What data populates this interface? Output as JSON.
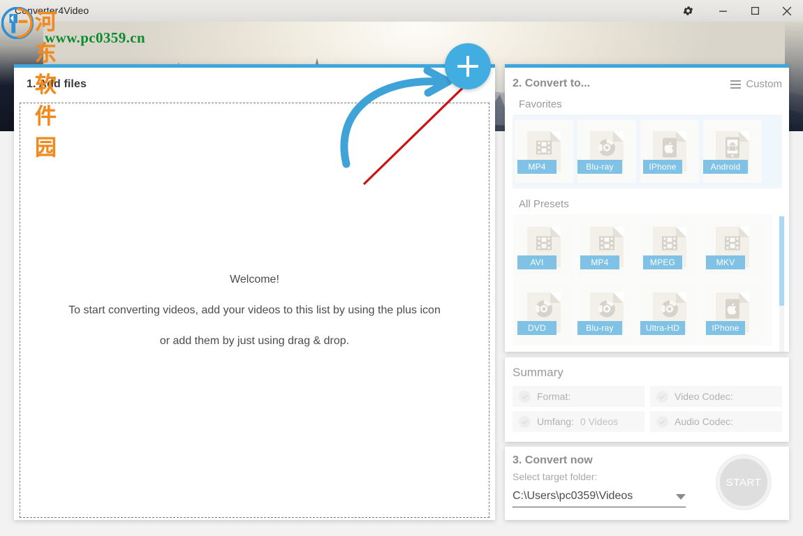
{
  "window": {
    "title": "Converter4Video",
    "controls": [
      {
        "name": "settings-button",
        "icon": "gear-icon"
      },
      {
        "name": "minimize-button",
        "icon": "minimize-icon"
      },
      {
        "name": "maximize-button",
        "icon": "maximize-icon"
      },
      {
        "name": "close-button",
        "icon": "close-icon"
      }
    ]
  },
  "watermark": {
    "chinese": "河东软件园",
    "url": "www.pc0359.cn"
  },
  "add_files": {
    "title": "1. Add files",
    "welcome_line1": "Welcome!",
    "welcome_line2": "To start converting videos, add your videos to this list by using the plus icon",
    "welcome_line3": "or add them by just using drag & drop.",
    "add_button_icon": "plus-icon"
  },
  "convert_to": {
    "title": "2. Convert to...",
    "custom_label": "Custom",
    "custom_icon": "hamburger-icon",
    "favorites_label": "Favorites",
    "favorites": [
      {
        "label": "MP4",
        "icon": "film-file-icon"
      },
      {
        "label": "Blu-ray",
        "icon": "disc-file-icon"
      },
      {
        "label": "IPhone",
        "icon": "apple-file-icon"
      },
      {
        "label": "Android",
        "icon": "android-file-icon"
      }
    ],
    "all_presets_label": "All Presets",
    "all_presets": [
      {
        "label": "AVI",
        "icon": "film-file-icon"
      },
      {
        "label": "MP4",
        "icon": "film-file-icon"
      },
      {
        "label": "MPEG",
        "icon": "film-file-icon"
      },
      {
        "label": "MKV",
        "icon": "film-file-icon"
      },
      {
        "label": "DVD",
        "icon": "disc-file-icon"
      },
      {
        "label": "Blu-ray",
        "icon": "disc-file-icon"
      },
      {
        "label": "Ultra-HD",
        "icon": "disc-file-icon"
      },
      {
        "label": "IPhone",
        "icon": "apple-file-icon"
      }
    ]
  },
  "summary": {
    "title": "Summary",
    "items": [
      {
        "label": "Format:",
        "value": ""
      },
      {
        "label": "Video Codec:",
        "value": ""
      },
      {
        "label": "Umfang:",
        "value": "0 Videos"
      },
      {
        "label": "Audio Codec:",
        "value": ""
      }
    ]
  },
  "convert_now": {
    "title": "3. Convert now",
    "folder_label": "Select target folder:",
    "folder_path": "C:\\Users\\pc0359\\Videos",
    "start_label": "START"
  },
  "annotations": {
    "curved_arrow": "blue-curved-arrow",
    "pointer_arrow": "red-pointer-arrow"
  },
  "colors": {
    "accent_blue": "#3ea6db",
    "plus_blue": "#41ade0",
    "tile_label_blue": "#7fc2e6",
    "scrollbar_blue": "#a9d9f2",
    "annotation_red": "#cc1212"
  }
}
